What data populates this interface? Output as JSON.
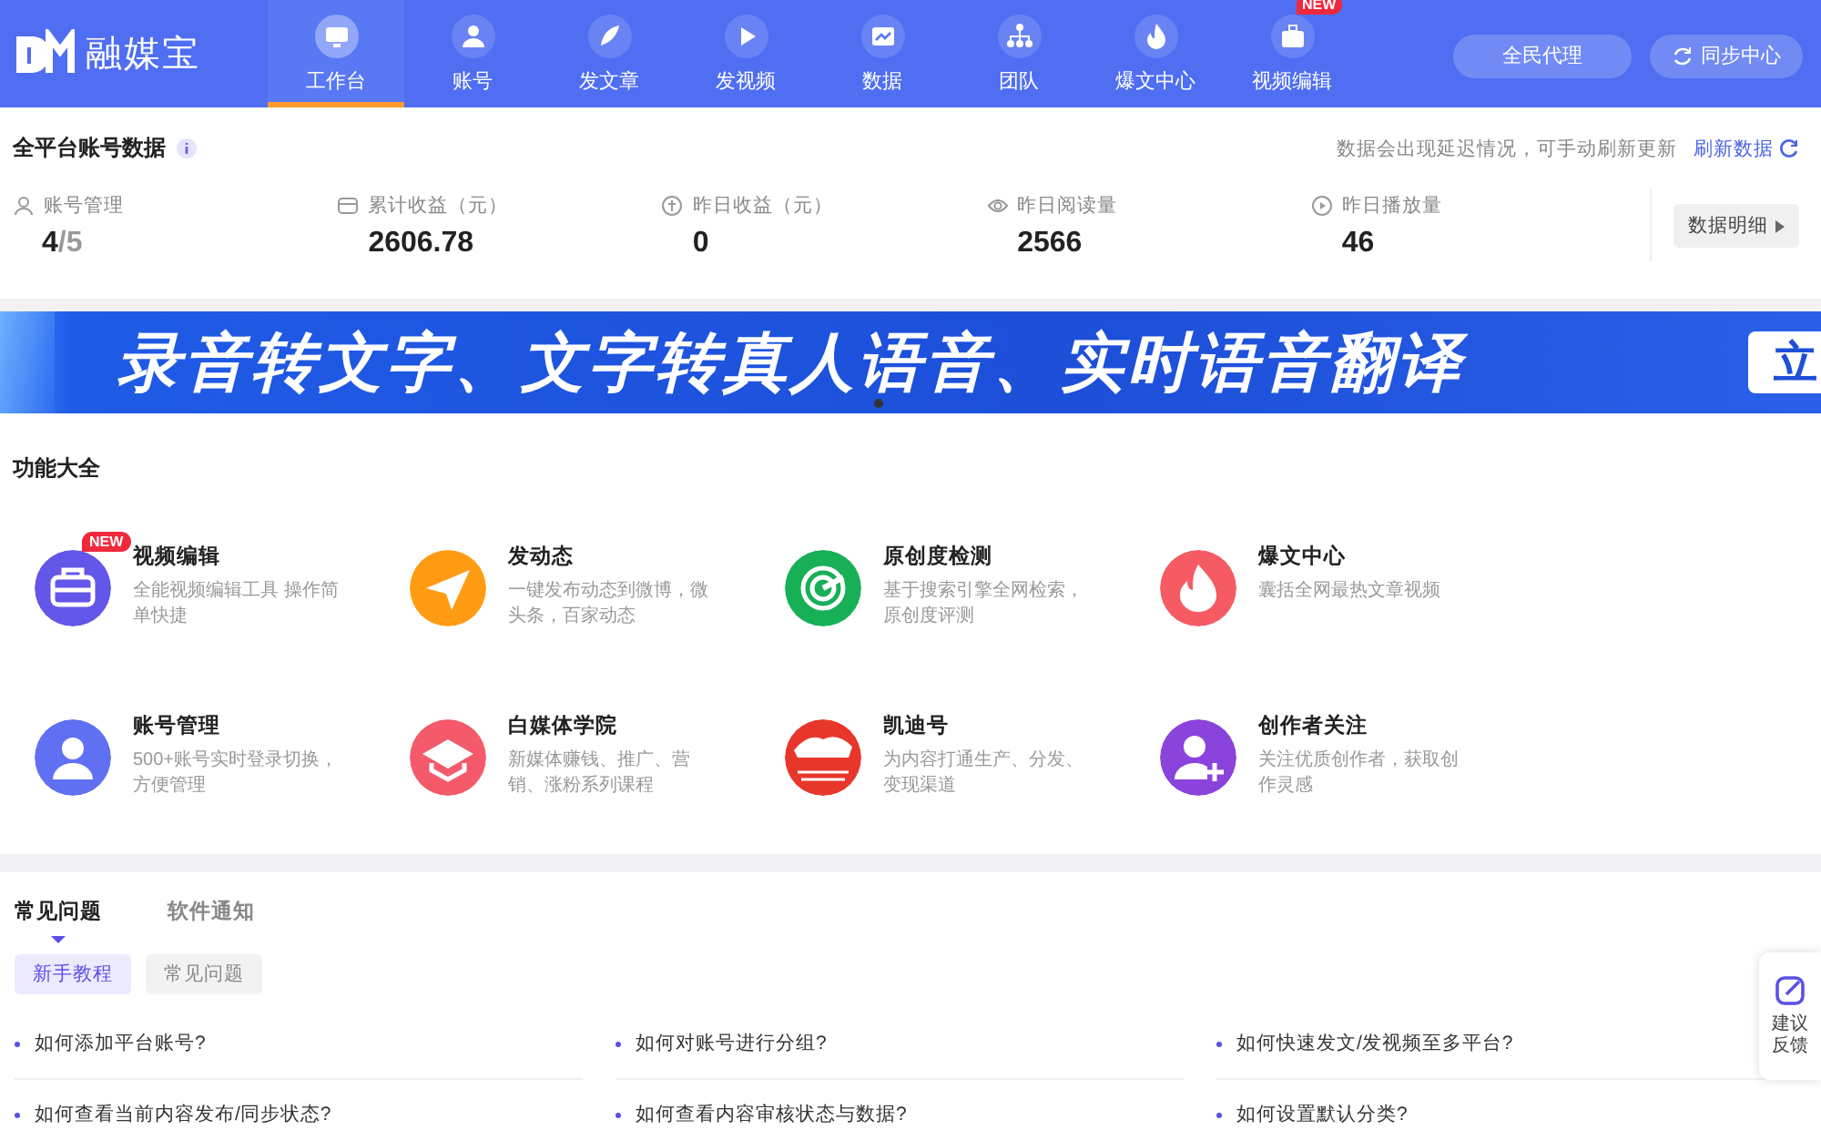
{
  "app": {
    "logo_text": "融媒宝"
  },
  "nav": [
    {
      "label": "工作台",
      "selected": true
    },
    {
      "label": "账号",
      "selected": false
    },
    {
      "label": "发文章",
      "selected": false
    },
    {
      "label": "发视频",
      "selected": false
    },
    {
      "label": "数据",
      "selected": false
    },
    {
      "label": "团队",
      "selected": false
    },
    {
      "label": "爆文中心",
      "selected": false
    },
    {
      "label": "视频编辑",
      "selected": false,
      "badge": "NEW"
    }
  ],
  "header_buttons": [
    "全民代理",
    "同步中心"
  ],
  "stats": {
    "title": "全平台账号数据",
    "notice": "数据会出现延迟情况，可手动刷新更新",
    "refresh": "刷新数据",
    "items": [
      {
        "label": "账号管理",
        "value": "4",
        "suffix": "/5"
      },
      {
        "label": "累计收益（元）",
        "value": "2606.78"
      },
      {
        "label": "昨日收益（元）",
        "value": "0"
      },
      {
        "label": "昨日阅读量",
        "value": "2566"
      },
      {
        "label": "昨日播放量",
        "value": "46"
      }
    ],
    "detail_button": "数据明细"
  },
  "banner": {
    "text": "录音转文字、文字转真人语音、实时语音翻译",
    "cut_text": "立"
  },
  "features": {
    "title": "功能大全",
    "items": [
      {
        "name": "视频编辑",
        "desc": "全能视频编辑工具 操作简单快捷",
        "color": "#6257e8",
        "badge": "NEW"
      },
      {
        "name": "发动态",
        "desc": "一键发布动态到微博，微头条，百家动态",
        "color": "#ff9c12"
      },
      {
        "name": "原创度检测",
        "desc": "基于搜索引擎全网检索，原创度评测",
        "color": "#17b057"
      },
      {
        "name": "爆文中心",
        "desc": "囊括全网最热文章视频",
        "color": "#f65b64"
      },
      {
        "name": "账号管理",
        "desc": "500+账号实时登录切换，方便管理",
        "color": "#5f70f2"
      },
      {
        "name": "白媒体学院",
        "desc": "新媒体赚钱、推广、营销、涨粉系列课程",
        "color": "#f45a6a"
      },
      {
        "name": "凯迪号",
        "desc": "为内容打通生产、分发、变现渠道",
        "color": "#e8362a"
      },
      {
        "name": "创作者关注",
        "desc": "关注优质创作者，获取创作灵感",
        "color": "#8a44dc"
      }
    ]
  },
  "faq": {
    "tabs": [
      {
        "label": "常见问题",
        "selected": true
      },
      {
        "label": "软件通知",
        "selected": false
      }
    ],
    "filters": [
      {
        "label": "新手教程",
        "selected": true
      },
      {
        "label": "常见问题",
        "selected": false
      }
    ],
    "questions": [
      "如何添加平台账号?",
      "如何对账号进行分组?",
      "如何快速发文/发视频至多平台?",
      "如何查看当前内容发布/同步状态?",
      "如何查看内容审核状态与数据?",
      "如何设置默认分类?"
    ]
  },
  "feedback": "建议反馈"
}
